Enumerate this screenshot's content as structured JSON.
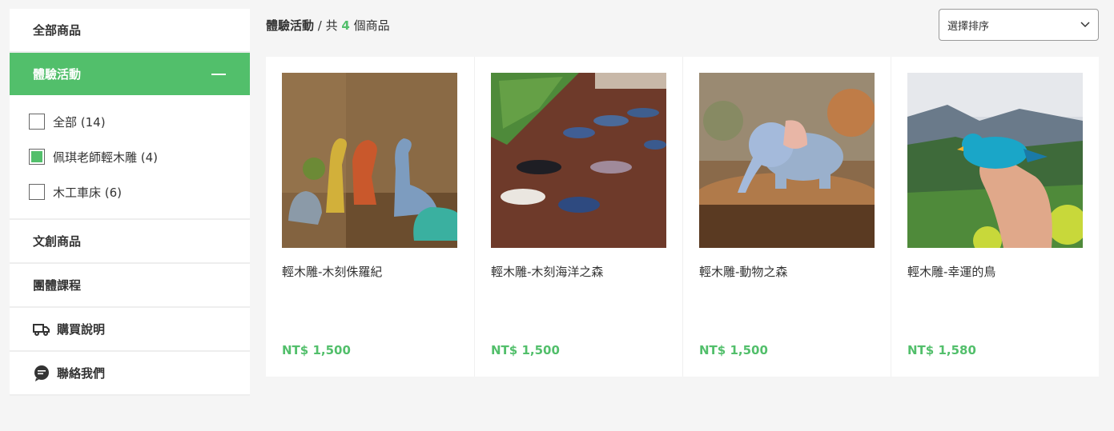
{
  "sidebar": {
    "all_products": "全部商品",
    "active_category": "體驗活動",
    "filters": [
      {
        "label": "全部 (14)",
        "checked": false
      },
      {
        "label": "佩琪老師輕木雕 (4)",
        "checked": true
      },
      {
        "label": "木工車床 (6)",
        "checked": false
      }
    ],
    "cultural": "文創商品",
    "group_course": "團體課程",
    "purchase_info": "購買說明",
    "contact_us": "聯絡我們"
  },
  "header": {
    "category": "體驗活動",
    "separator": " / 共 ",
    "count": "4",
    "suffix": " 個商品",
    "sort_placeholder": "選擇排序"
  },
  "products": [
    {
      "title": "輕木雕-木刻侏羅紀",
      "price": "NT$ 1,500"
    },
    {
      "title": "輕木雕-木刻海洋之森",
      "price": "NT$ 1,500"
    },
    {
      "title": "輕木雕-動物之森",
      "price": "NT$ 1,500"
    },
    {
      "title": "輕木雕-幸運的鳥",
      "price": "NT$ 1,580"
    }
  ],
  "colors": {
    "accent": "#52bf6b"
  },
  "icons": [
    "minus-icon",
    "truck-icon",
    "chat-icon",
    "chevron-down-icon"
  ]
}
